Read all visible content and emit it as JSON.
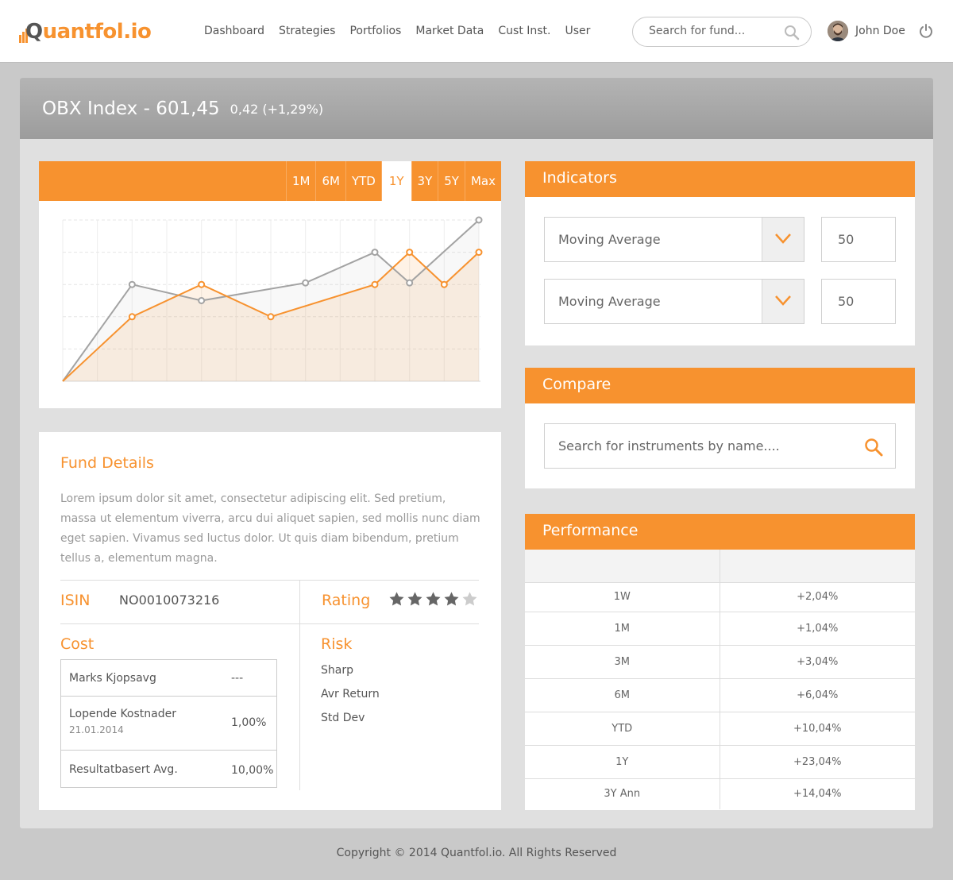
{
  "brand": {
    "logo_q": "Q",
    "logo_main": "uantfol.io"
  },
  "nav": [
    "Dashboard",
    "Strategies",
    "Portfolios",
    "Market Data",
    "Cust Inst.",
    "User"
  ],
  "search": {
    "placeholder": "Search for fund..."
  },
  "user": {
    "name": "John Doe"
  },
  "index": {
    "title": "OBX Index - 601,45",
    "change": "0,42 (+1,29%)"
  },
  "ranges": [
    "1M",
    "6M",
    "YTD",
    "1Y",
    "3Y",
    "5Y",
    "Max"
  ],
  "active_range": "1Y",
  "colors": {
    "accent": "#f7922f",
    "gray_series": "#a3a3a3"
  },
  "chart_data": {
    "type": "line",
    "x": [
      0,
      1,
      2,
      3,
      4,
      5,
      6,
      7,
      8,
      9,
      10,
      11,
      12
    ],
    "ylim": [
      0,
      10
    ],
    "grid": true,
    "series": [
      {
        "color": "#a3a3a3",
        "points": [
          [
            0,
            0
          ],
          [
            2,
            6
          ],
          [
            4,
            5
          ],
          [
            7,
            6.1
          ],
          [
            9,
            8
          ],
          [
            10,
            6.1
          ],
          [
            12,
            10
          ]
        ]
      },
      {
        "color": "#f7922f",
        "points": [
          [
            0,
            0
          ],
          [
            2,
            4
          ],
          [
            4,
            6
          ],
          [
            6,
            4
          ],
          [
            9,
            6
          ],
          [
            10,
            8
          ],
          [
            11,
            6
          ],
          [
            12,
            8
          ]
        ]
      }
    ]
  },
  "fund_details": {
    "title": "Fund Details",
    "description": "Lorem ipsum dolor sit amet, consectetur adipiscing elit. Sed pretium, massa ut elementum viverra, arcu dui aliquet sapien, sed mollis nunc diam eget sapien. Vivamus sed luctus dolor. Ut quis diam bibendum, pretium tellus a, elementum magna.",
    "isin_label": "ISIN",
    "isin": "NO0010073216",
    "rating_label": "Rating",
    "rating": 4,
    "rating_max": 5,
    "cost_label": "Cost",
    "cost": [
      {
        "name": "Marks Kjopsavg",
        "date": "",
        "value": "---"
      },
      {
        "name": "Lopende Kostnader",
        "date": "21.01.2014",
        "value": "1,00%"
      },
      {
        "name": "Resultatbasert Avg.",
        "date": "",
        "value": "10,00%"
      }
    ],
    "risk_label": "Risk",
    "risk": [
      "Sharp",
      "Avr Return",
      "Std Dev"
    ]
  },
  "indicators": {
    "title": "Indicators",
    "rows": [
      {
        "type": "Moving Average",
        "value": "50"
      },
      {
        "type": "Moving Average",
        "value": "50"
      }
    ]
  },
  "compare": {
    "title": "Compare",
    "placeholder": "Search for instruments by name...."
  },
  "performance": {
    "title": "Performance",
    "rows": [
      {
        "period": "1W",
        "value": "+2,04%"
      },
      {
        "period": "1M",
        "value": "+1,04%"
      },
      {
        "period": "3M",
        "value": "+3,04%"
      },
      {
        "period": "6M",
        "value": "+6,04%"
      },
      {
        "period": "YTD",
        "value": "+10,04%"
      },
      {
        "period": "1Y",
        "value": "+23,04%"
      },
      {
        "period": "3Y Ann",
        "value": "+14,04%"
      }
    ]
  },
  "footer": "Copyright © 2014 Quantfol.io. All Rights Reserved"
}
